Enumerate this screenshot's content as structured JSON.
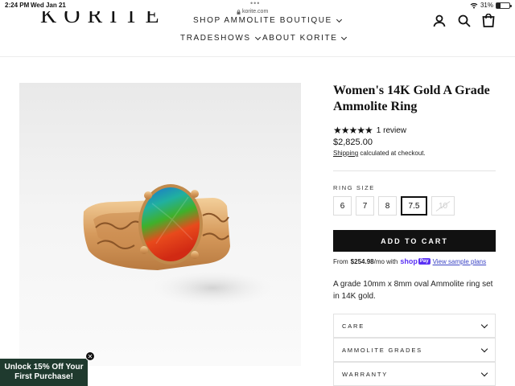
{
  "status_bar": {
    "time": "2:24 PM",
    "date": "Wed Jan 21",
    "url": "korite.com",
    "battery": "31%",
    "battery_level": 0.31,
    "icons": [
      "wifi-icon",
      "battery-icon",
      "lock-icon"
    ]
  },
  "header": {
    "logo": "KORITE",
    "nav": {
      "shop": "SHOP AMMOLITE BOUTIQUE",
      "tradeshows": "TRADESHOWS",
      "about": "ABOUT KORITE"
    },
    "icons": [
      "account-icon",
      "search-icon",
      "cart-icon"
    ]
  },
  "product": {
    "title": "Women's 14K Gold A Grade Ammolite Ring",
    "stars": "★★★★★",
    "rating_value": 5,
    "review_count": "1 review",
    "price": "$2,825.00",
    "shipping_link": "Shipping",
    "shipping_rest": " calculated at checkout.",
    "ring_size_label": "RING SIZE",
    "sizes": [
      "6",
      "7",
      "8",
      "7.5",
      "10"
    ],
    "selected_size": "7.5",
    "unavailable_size": "10",
    "add_to_cart": "ADD TO CART",
    "shoppay": {
      "from": "From",
      "amount": "$254.98",
      "per": "/mo with",
      "brand": "shop",
      "brand_badge": "Pay",
      "sample_link": "View sample plans"
    },
    "description": "A grade 10mm x 8mm oval Ammolite ring set in 14K gold.",
    "accordions": [
      "CARE",
      "AMMOLITE GRADES",
      "WARRANTY"
    ]
  },
  "promo": {
    "text": "Unlock 15% Off Your First Purchase!",
    "close": "✕"
  },
  "colors": {
    "accent": "#111111",
    "promo_bg": "#1f3a2e",
    "shoppay": "#5a31f4"
  }
}
